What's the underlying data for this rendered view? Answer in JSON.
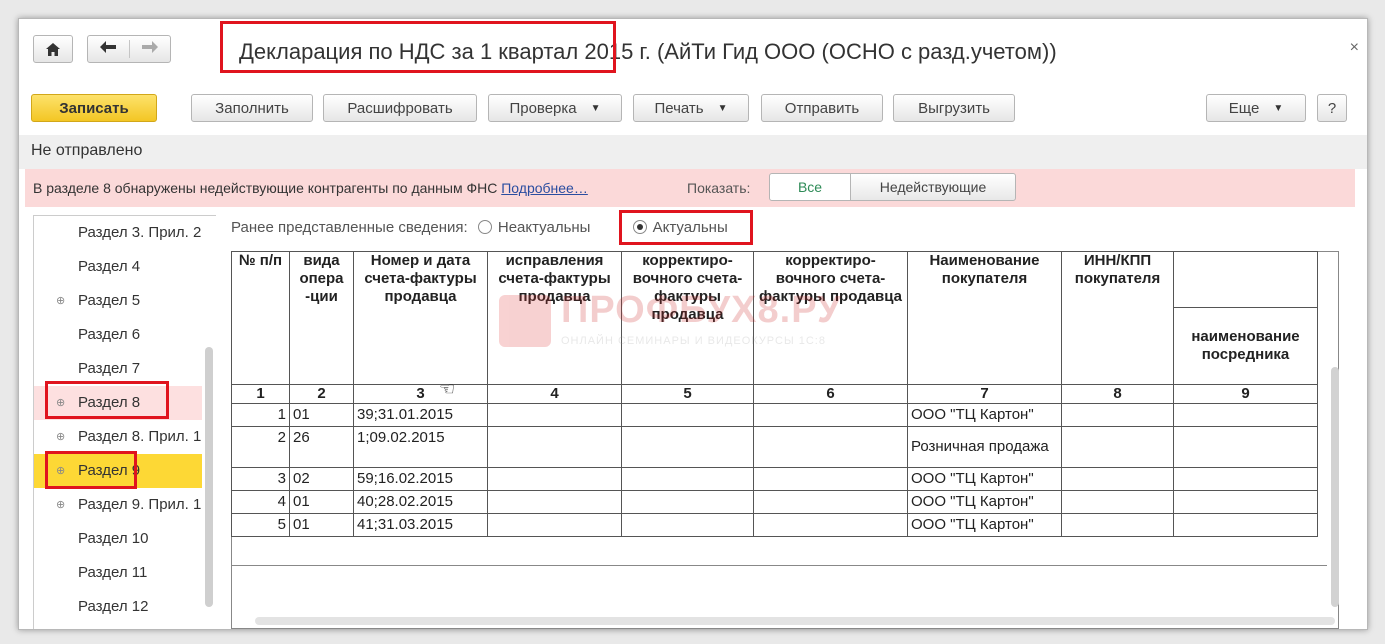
{
  "window": {
    "title": "Декларация по НДС за 1 квартал 2015 г. (АйТи Гид ООО (ОСНО с разд.учетом))",
    "close_glyph": "×"
  },
  "nav": {
    "home_icon": "home-icon",
    "back_icon": "arrow-left-icon",
    "forward_icon": "arrow-right-icon"
  },
  "toolbar": {
    "save": "Записать",
    "fill": "Заполнить",
    "decode": "Расшифровать",
    "check": "Проверка",
    "print": "Печать",
    "send": "Отправить",
    "export": "Выгрузить",
    "more": "Еще",
    "help": "?"
  },
  "status": "Не отправлено",
  "warning": {
    "text": "В разделе 8 обнаружены недействующие контрагенты по данным ФНС",
    "link": "Подробнее…",
    "show_label": "Показать:",
    "option_all": "Все",
    "option_inactive": "Недействующие",
    "bg_color": "#fbd9d9"
  },
  "sidebar": {
    "items": [
      {
        "label": "Раздел 3. Прил. 2",
        "expandable": false
      },
      {
        "label": "Раздел 4",
        "expandable": false
      },
      {
        "label": "Раздел 5",
        "expandable": true
      },
      {
        "label": "Раздел 6",
        "expandable": false
      },
      {
        "label": "Раздел 7",
        "expandable": false
      },
      {
        "label": "Раздел 8",
        "expandable": true
      },
      {
        "label": "Раздел 8. Прил. 1",
        "expandable": true
      },
      {
        "label": "Раздел 9",
        "expandable": true
      },
      {
        "label": "Раздел 9. Прил. 1",
        "expandable": true
      },
      {
        "label": "Раздел 10",
        "expandable": false
      },
      {
        "label": "Раздел 11",
        "expandable": false
      },
      {
        "label": "Раздел 12",
        "expandable": false
      }
    ],
    "selected_color": "#fdd835",
    "highlight_color": "#fde0e0"
  },
  "info": {
    "label": "Ранее представленные сведения:",
    "option_irrelevant": "Неактуальны",
    "option_actual": "Актуальны"
  },
  "table": {
    "headers": [
      "№ п/п",
      "вида опера -ции",
      "Номер и дата счета-фактуры продавца",
      "исправления счета-фактуры продавца",
      "корректиро-вочного счета-фактуры продавца",
      "корректиро-вочного счета-фактуры продавца",
      "Наименование покупателя",
      "ИНН/КПП покупателя",
      "наименование посредника"
    ],
    "col_numbers": [
      "1",
      "2",
      "3",
      "4",
      "5",
      "6",
      "7",
      "8",
      "9"
    ],
    "rows": [
      {
        "n": "1",
        "op": "01",
        "invoice": "39;31.01.2015",
        "buyer": "ООО \"ТЦ Картон\""
      },
      {
        "n": "2",
        "op": "26",
        "invoice": "1;09.02.2015",
        "buyer": "Розничная продажа"
      },
      {
        "n": "3",
        "op": "02",
        "invoice": "59;16.02.2015",
        "buyer": "ООО \"ТЦ Картон\""
      },
      {
        "n": "4",
        "op": "01",
        "invoice": "40;28.02.2015",
        "buyer": "ООО \"ТЦ Картон\""
      },
      {
        "n": "5",
        "op": "01",
        "invoice": "41;31.03.2015",
        "buyer": "ООО \"ТЦ Картон\""
      }
    ]
  },
  "watermark": {
    "text": "ПРОФБУХ8.РУ",
    "sub": "ОНЛАЙН СЕМИНАРЫ И ВИДЕОКУРСЫ 1С:8"
  },
  "colors": {
    "accent_red": "#e0141e",
    "save_yellow": "#f3c624",
    "link_blue": "#2a4da0"
  }
}
